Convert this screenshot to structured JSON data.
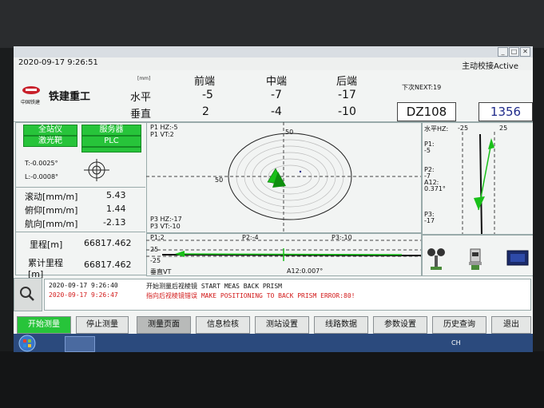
{
  "window": {
    "title": "",
    "min": "_",
    "max": "□",
    "close": "✕"
  },
  "header": {
    "datetime": "2020-09-17 9:26:51",
    "active_label": "主动校接Active"
  },
  "brand": {
    "small": "中国铁建",
    "name": "铁建重工"
  },
  "table": {
    "unit": "[mm]",
    "cols": [
      "前端",
      "中端",
      "后端"
    ],
    "rows": [
      {
        "label": "水平",
        "values": [
          "-5",
          "-7",
          "-17"
        ]
      },
      {
        "label": "垂直",
        "values": [
          "2",
          "-4",
          "-10"
        ]
      }
    ]
  },
  "next": "下次NEXT:19",
  "dz": "DZ108",
  "ring_no": "1356",
  "status_buttons": [
    "全站仪",
    "服务器",
    "激光靶",
    "PLC"
  ],
  "target": {
    "t": "T:-0.0025°",
    "l": "L:-0.0008°"
  },
  "attitude": [
    {
      "label": "滚动[mm/m]",
      "value": "5.43"
    },
    {
      "label": "俯仰[mm/m]",
      "value": "1.44"
    },
    {
      "label": "航向[mm/m]",
      "value": "-2.13"
    }
  ],
  "mileage": [
    {
      "label": "里程[m]",
      "value": "66817.462"
    },
    {
      "label": "累计里程[m]",
      "value": "66817.462"
    }
  ],
  "target_view": {
    "p1_hz": "P1 HZ:-5",
    "p1_vt": "P1 VT:2",
    "p3_hz": "P3 HZ:-17",
    "p3_vt": "P3 VT:-10",
    "n50_top": "50",
    "n50_left": "50"
  },
  "profile": {
    "p1": "P1:2",
    "p2": "P2:-4",
    "p3": "P3:-10",
    "plus25": "25",
    "minus25": "-25",
    "vt": "垂直VT",
    "a12": "A12:0.007°"
  },
  "side": {
    "hz": "水平HZ:",
    "hz_top": "-25",
    "hz_right": "25",
    "p1": "P1:",
    "p1v": "-5",
    "p2": "P2:",
    "p2v": "-7",
    "a12": "A12:",
    "a12v": "0.371°",
    "p3": "P3:",
    "p3v": "-17"
  },
  "log": [
    {
      "time": "2020-09-17 9:26:40",
      "msg": "开始测量后视棱镜 START MEAS BACK PRISM",
      "color": "#111111"
    },
    {
      "time": "2020-09-17 9:26:47",
      "msg": "指向后视棱镜错误 MAKE POSITIONING TO BACK PRISM ERROR:80!",
      "color": "#d21a1a"
    }
  ],
  "buttons": [
    "开始测量",
    "停止测量",
    "测量页面",
    "信息检核",
    "测站设置",
    "线路数据",
    "参数设置",
    "历史查询",
    "退出"
  ],
  "taskbar": {
    "lang": "CH"
  },
  "colors": {
    "green": "#27c43a",
    "arrow": "#19c019",
    "blue_num": "#1f2a8a",
    "red_log": "#d21a1a"
  }
}
